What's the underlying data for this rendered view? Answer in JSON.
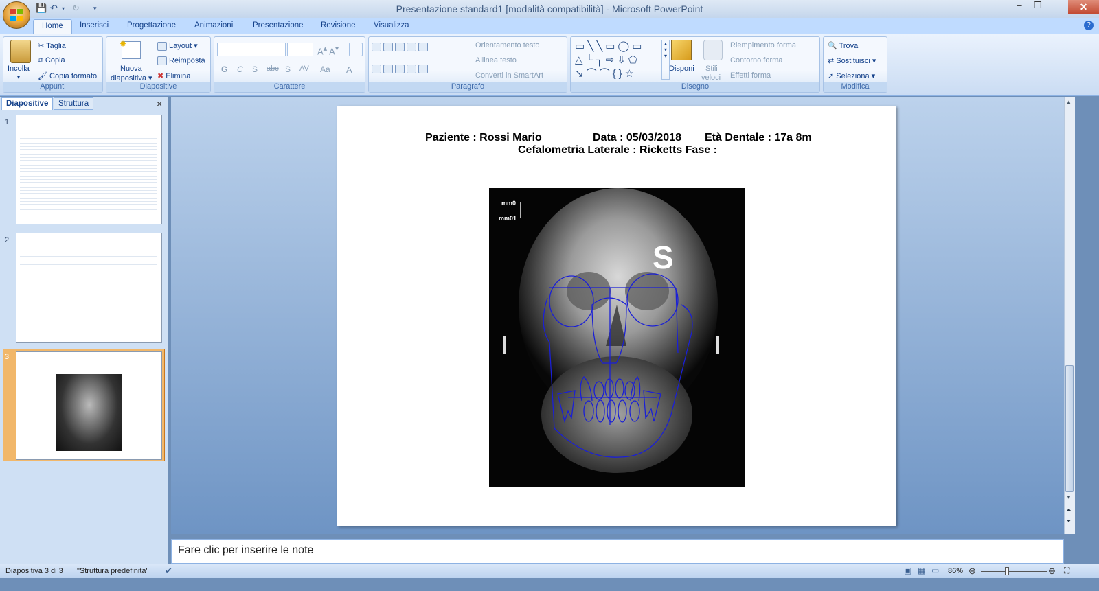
{
  "window": {
    "title": "Presentazione standard1 [modalità compatibilità] - Microsoft PowerPoint",
    "minimize": "–",
    "restore": "❐",
    "close": "✕"
  },
  "tabs": [
    "Home",
    "Inserisci",
    "Progettazione",
    "Animazioni",
    "Presentazione",
    "Revisione",
    "Visualizza"
  ],
  "ribbon": {
    "appunti": {
      "label": "Appunti",
      "incolla": "Incolla",
      "taglia": "Taglia",
      "copia": "Copia",
      "copia_formato": "Copia formato"
    },
    "diapositive": {
      "label": "Diapositive",
      "nuova": "Nuova",
      "nuova2": "diapositiva",
      "layout": "Layout",
      "reimposta": "Reimposta",
      "elimina": "Elimina"
    },
    "carattere": {
      "label": "Carattere",
      "g": "G",
      "c": "C",
      "s": "S",
      "abc": "abc",
      "s2": "S",
      "av": "AV",
      "aa": "Aa",
      "a": "A"
    },
    "paragrafo": {
      "label": "Paragrafo",
      "orientamento": "Orientamento testo",
      "allinea": "Allinea testo",
      "converti": "Converti in SmartArt"
    },
    "disegno": {
      "label": "Disegno",
      "disponi": "Disponi",
      "stili": "Stili",
      "veloci": "veloci",
      "riempimento": "Riempimento forma",
      "contorno": "Contorno forma",
      "effetti": "Effetti forma"
    },
    "modifica": {
      "label": "Modifica",
      "trova": "Trova",
      "sostituisci": "Sostituisci",
      "seleziona": "Seleziona"
    }
  },
  "panel": {
    "tab_diapositive": "Diapositive",
    "tab_struttura": "Struttura",
    "close": "×",
    "slides": [
      "1",
      "2",
      "3"
    ]
  },
  "slide": {
    "paziente": "Paziente : Rossi Mario",
    "data": "Data : 05/03/2018",
    "eta": "Età Dentale : 17a 8m",
    "cefalometria": "Cefalometria Laterale : Ricketts  Fase :",
    "ruler_top": "mm0",
    "ruler_bottom": "mm01",
    "s_marker": "S"
  },
  "notes": {
    "placeholder": "Fare clic per inserire le note"
  },
  "status": {
    "slide_of": "Diapositiva 3 di 3",
    "theme": "\"Struttura predefinita\"",
    "zoom": "86%"
  },
  "colors": {
    "accent": "#15428b",
    "tracing": "#1a1fd6",
    "selected": "#f1b76a"
  }
}
